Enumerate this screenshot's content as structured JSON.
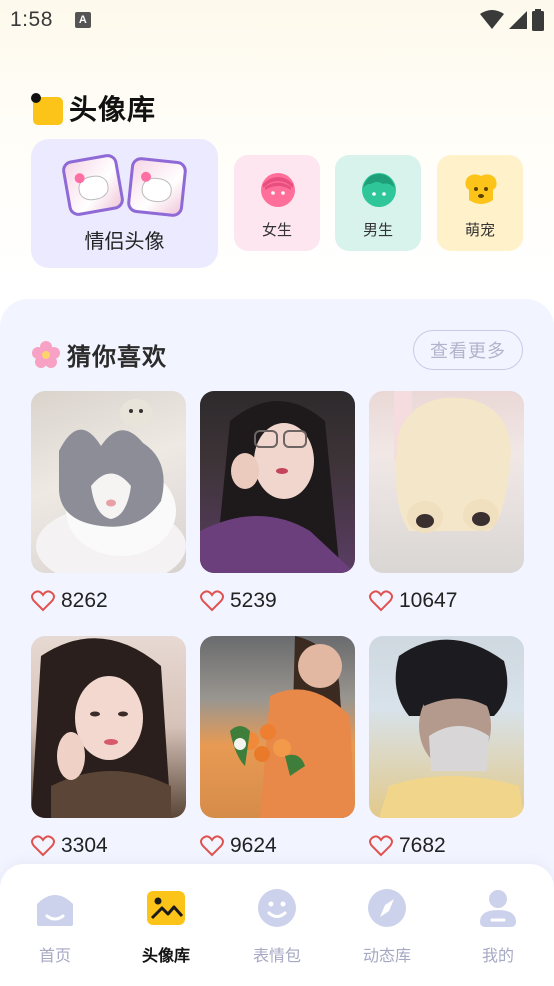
{
  "status_bar": {
    "time": "1:58",
    "notification_letter": "A"
  },
  "header": {
    "title": "头像库"
  },
  "categories": {
    "couple": {
      "label": "情侣头像"
    },
    "items": [
      {
        "label": "女生",
        "icon": "girl-face-icon",
        "color": "#ff6f9a"
      },
      {
        "label": "男生",
        "icon": "boy-face-icon",
        "color": "#2fc79a"
      },
      {
        "label": "萌宠",
        "icon": "dog-face-icon",
        "color": "#fcc419"
      }
    ]
  },
  "recommend": {
    "title": "猜你喜欢",
    "more_label": "查看更多",
    "items": [
      {
        "likes": "8262",
        "subject": "cat"
      },
      {
        "likes": "5239",
        "subject": "girl-glasses"
      },
      {
        "likes": "10647",
        "subject": "fluffy-dog"
      },
      {
        "likes": "3304",
        "subject": "girl-portrait"
      },
      {
        "likes": "9624",
        "subject": "girl-flowers"
      },
      {
        "likes": "7682",
        "subject": "boy-portrait"
      }
    ]
  },
  "bottom_nav": {
    "items": [
      {
        "label": "首页",
        "icon": "home-icon",
        "active": false
      },
      {
        "label": "头像库",
        "icon": "image-icon",
        "active": true
      },
      {
        "label": "表情包",
        "icon": "smile-icon",
        "active": false
      },
      {
        "label": "动态库",
        "icon": "compass-icon",
        "active": false
      },
      {
        "label": "我的",
        "icon": "profile-icon",
        "active": false
      }
    ]
  },
  "colors": {
    "accent": "#fcc419",
    "heart": "#e0524f",
    "nav_inactive": "#a6a8c4"
  }
}
